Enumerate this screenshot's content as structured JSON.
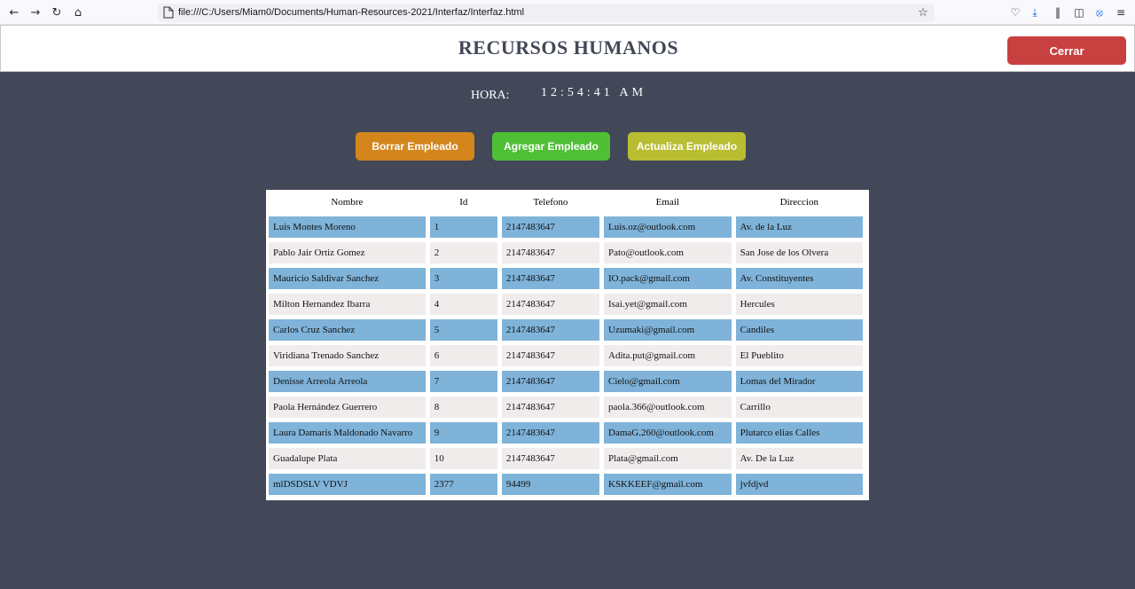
{
  "browser": {
    "url": "file:///C:/Users/Miam0/Documents/Human-Resources-2021/Interfaz/Interfaz.html"
  },
  "header": {
    "title": "RECURSOS HUMANOS",
    "close_label": "Cerrar"
  },
  "clock": {
    "label": "HORA:",
    "value": "12:54:41 AM"
  },
  "actions": {
    "delete_label": "Borrar Empleado",
    "add_label": "Agregar Empleado",
    "update_label": "Actualiza Empleado"
  },
  "table": {
    "headers": [
      "Nombre",
      "Id",
      "Telefono",
      "Email",
      "Direccion"
    ],
    "rows": [
      [
        "Luis Montes Moreno",
        "1",
        "2147483647",
        "Luis.oz@outlook.com",
        "Av. de la Luz"
      ],
      [
        "Pablo Jair Ortiz Gomez",
        "2",
        "2147483647",
        "Pato@outlook.com",
        "San Jose de los Olvera"
      ],
      [
        "Mauricio Saldivar Sanchez",
        "3",
        "2147483647",
        "IO.pack@gmail.com",
        "Av. Constituyentes"
      ],
      [
        "Milton Hernandez Ibarra",
        "4",
        "2147483647",
        "Isai.yet@gmail.com",
        "Hercules"
      ],
      [
        "Carlos Cruz Sanchez",
        "5",
        "2147483647",
        "Uzumaki@gmail.com",
        "Candiles"
      ],
      [
        "Viridiana Trenado Sanchez",
        "6",
        "2147483647",
        "Adita.put@gmail.com",
        "El Pueblito"
      ],
      [
        "Denisse Arreola Arreola",
        "7",
        "2147483647",
        "Cielo@gmail.com",
        "Lomas del Mirador"
      ],
      [
        "Paola Hernández Guerrero",
        "8",
        "2147483647",
        "paola.366@outlook.com",
        "Carrillo"
      ],
      [
        "Laura Damaris Maldonado Navarro",
        "9",
        "2147483647",
        "DamaG.260@outlook.com",
        "Plutarco elias Calles"
      ],
      [
        "Guadalupe Plata",
        "10",
        "2147483647",
        "Plata@gmail.com",
        "Av. De la Luz"
      ],
      [
        "mlDSDSLV VDVJ",
        "2377",
        "94499",
        "KSKKEEF@gmail.com",
        "jvfdjvd"
      ]
    ]
  },
  "colors": {
    "background": "#434859",
    "close_button": "#c94040",
    "delete_button": "#d4861d",
    "add_button": "#4fbf35",
    "update_button": "#b8bd32",
    "row_highlight": "#7fb3d9",
    "row_plain": "#f0ecec"
  }
}
